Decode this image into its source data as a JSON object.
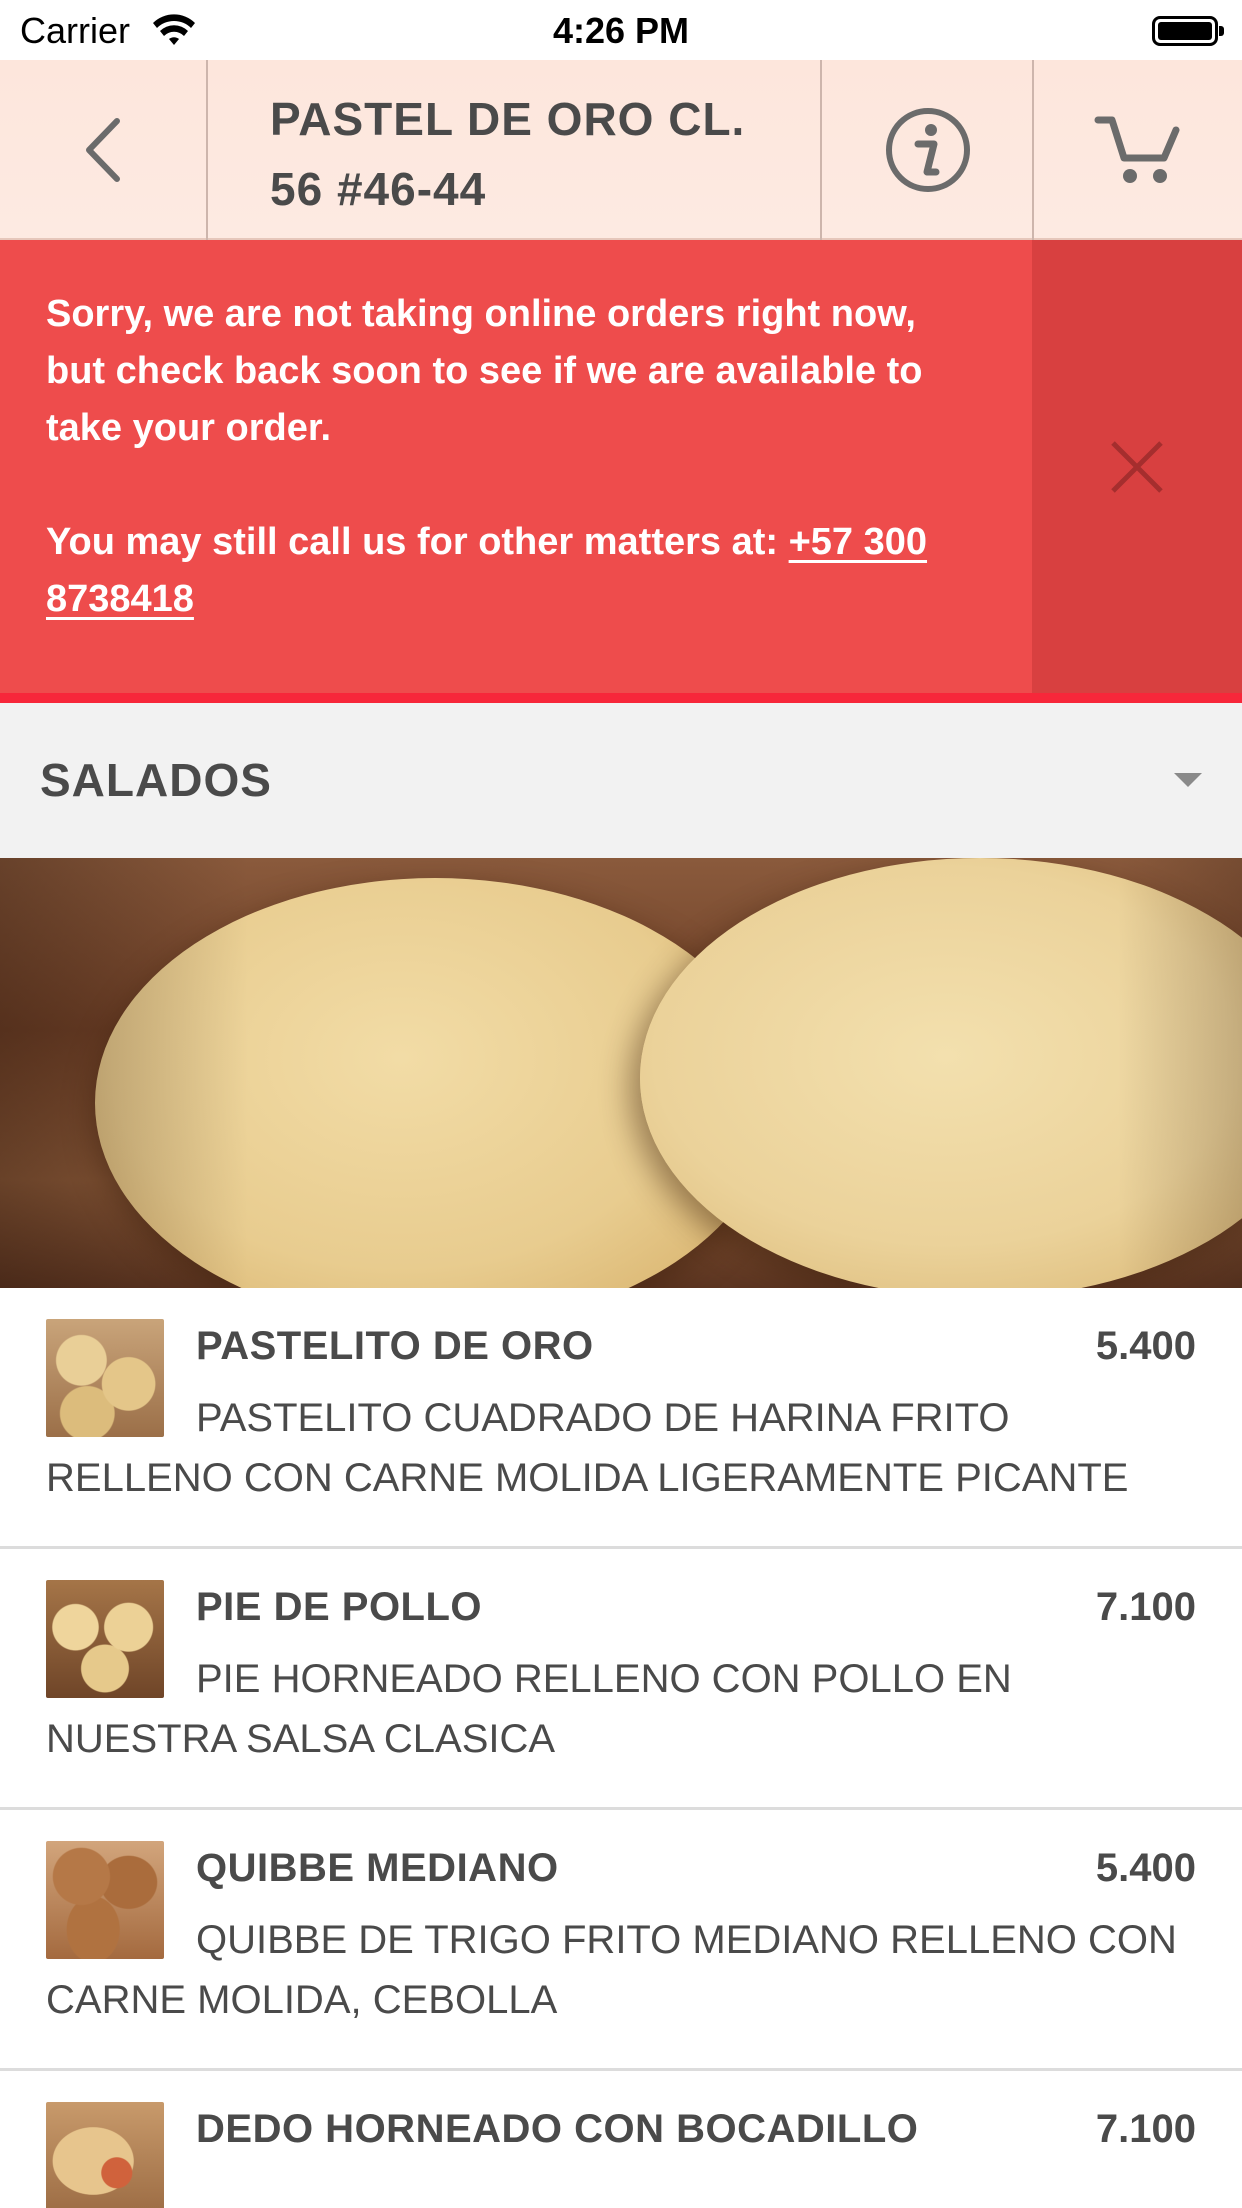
{
  "status_bar": {
    "carrier": "Carrier",
    "time": "4:26 PM"
  },
  "header": {
    "title_line1": "PASTEL DE ORO CL.",
    "title_line2": "56 #46-44",
    "back_icon": "chevron-left-icon",
    "info_icon": "info-icon",
    "cart_icon": "cart-icon"
  },
  "alert": {
    "message": "Sorry, we are not taking online orders right now, but check back soon to see if we are available to take your order.",
    "call_prefix": "You may still call us for other matters at: ",
    "phone": "+57 300 8738418",
    "close_icon": "close-icon"
  },
  "category": {
    "label": "SALADOS"
  },
  "menu_items": [
    {
      "name": "PASTELITO DE ORO",
      "price": "5.400",
      "description": "PASTELITO CUADRADO DE HARINA FRITO RELLENO CON CARNE MOLIDA LIGERAMENTE PICANTE"
    },
    {
      "name": "PIE DE POLLO",
      "price": "7.100",
      "description": "PIE HORNEADO RELLENO CON POLLO EN NUESTRA SALSA CLASICA"
    },
    {
      "name": "QUIBBE MEDIANO",
      "price": "5.400",
      "description": "QUIBBE DE TRIGO FRITO MEDIANO RELLENO CON CARNE MOLIDA, CEBOLLA"
    },
    {
      "name": "DEDO HORNEADO CON BOCADILLO",
      "price": "7.100",
      "description": ""
    }
  ],
  "colors": {
    "header_bg": "#fde6dc",
    "alert_bg": "#ee4c4c",
    "alert_close_bg": "#d84040",
    "alert_border": "#f7273a",
    "category_bg": "#f2f2f2",
    "text": "#4a4a4a"
  }
}
